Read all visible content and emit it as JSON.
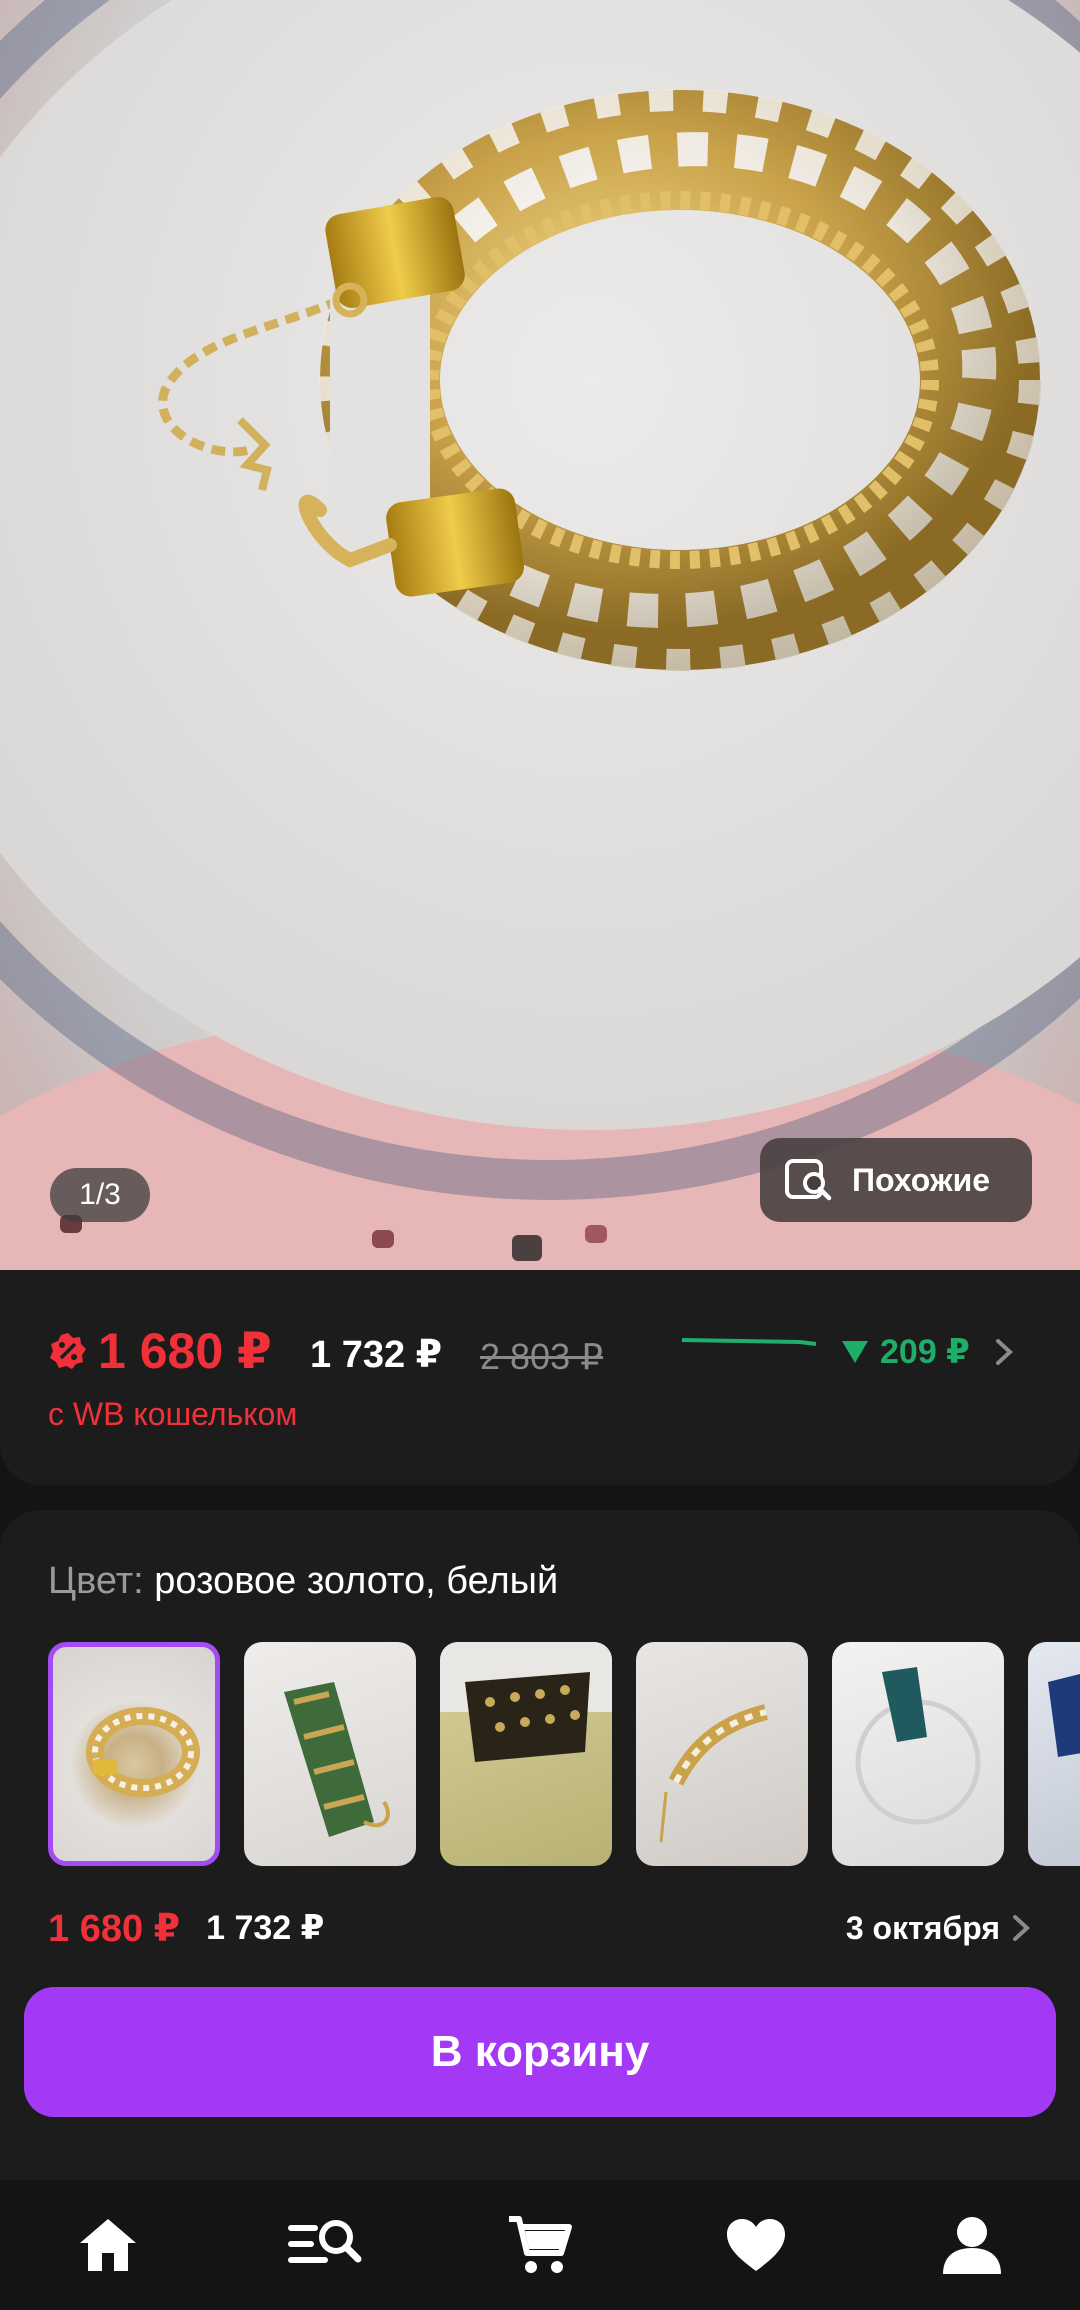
{
  "gallery": {
    "counter": "1/3",
    "similar_label": "Похожие"
  },
  "price": {
    "wallet_price": "1 680 ₽",
    "regular_price": "1 732 ₽",
    "old_price": "2 803 ₽",
    "wallet_label": "с WB кошельком",
    "price_drop": "209 ₽"
  },
  "variants": {
    "color_key": "Цвет:",
    "color_value": "розовое золото, белый",
    "selected_price_wallet": "1 680 ₽",
    "selected_price": "1 732 ₽",
    "delivery_date": "3 октября"
  },
  "actions": {
    "add_to_cart": "В корзину"
  },
  "nav": {
    "items": [
      "home-icon",
      "catalog-search-icon",
      "cart-icon",
      "favorites-heart-icon",
      "profile-icon"
    ]
  },
  "colors": {
    "accent": "#a339f5",
    "price_red": "#f2303a",
    "price_drop_green": "#1fae6a",
    "background": "#141414",
    "card": "#1c1c1c"
  }
}
